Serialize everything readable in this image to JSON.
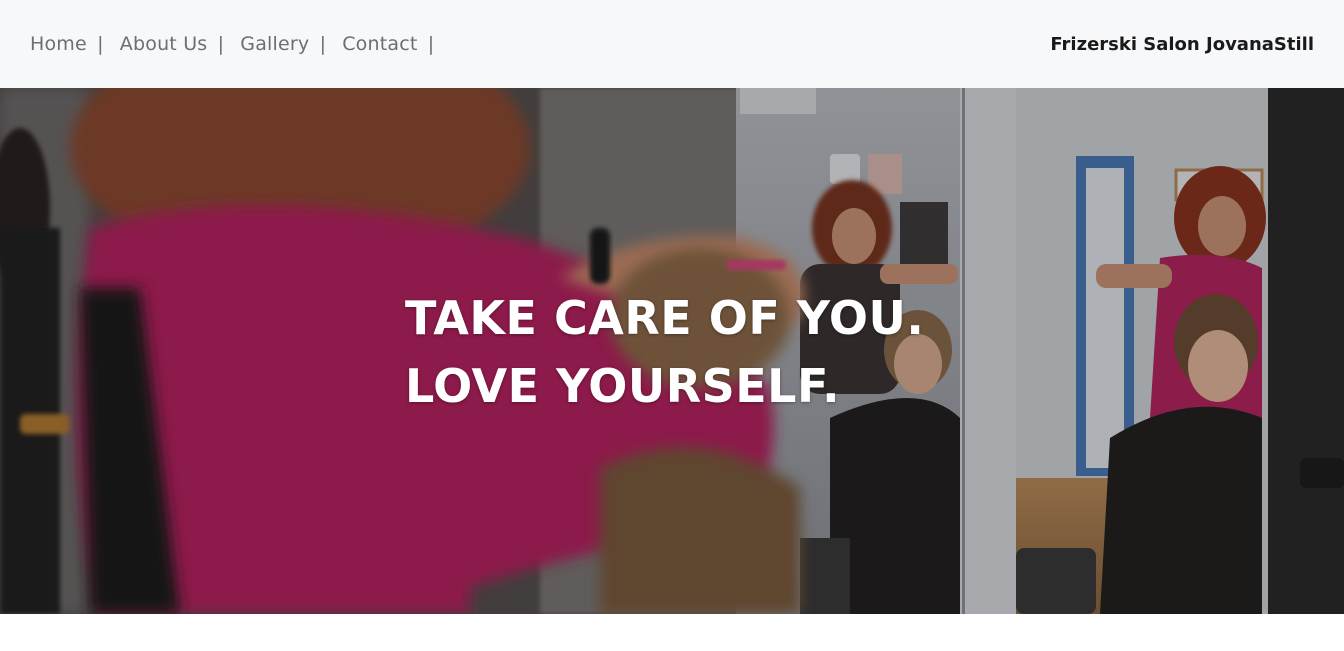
{
  "nav": {
    "items": [
      {
        "label": "Home",
        "sep": "|"
      },
      {
        "label": "About Us",
        "sep": "|"
      },
      {
        "label": "Gallery",
        "sep": "|"
      },
      {
        "label": "Contact",
        "sep": "|"
      }
    ]
  },
  "brand": {
    "name": "Frizerski Salon JovanaStill"
  },
  "hero": {
    "line1": "TAKE CARE OF YOU.",
    "line2": "LOVE YOURSELF.",
    "image_description_icon": "salon-photo",
    "colors": {
      "shirt": "#b4245f",
      "wall": "#c9ccd1",
      "door": "#4a78b5"
    }
  }
}
